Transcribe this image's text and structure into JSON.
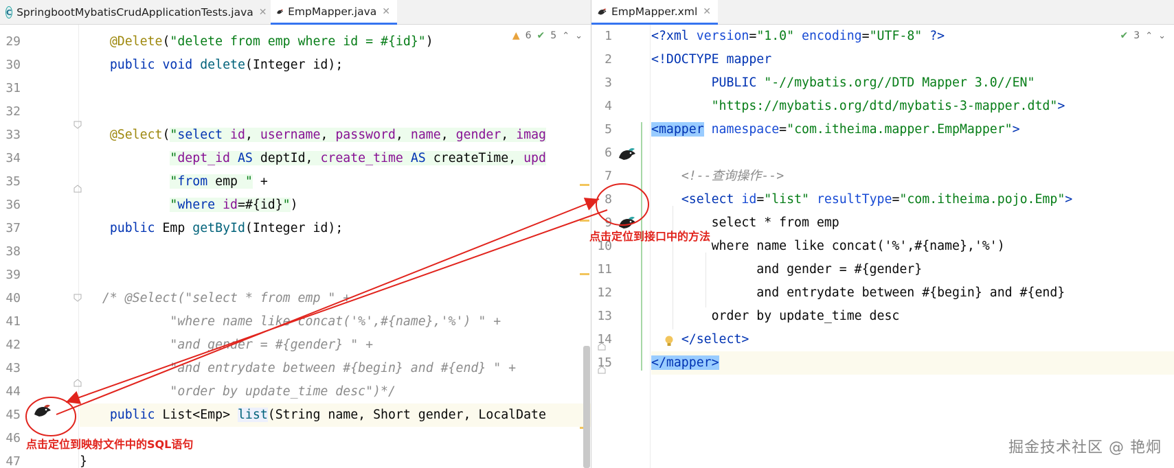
{
  "left_editor": {
    "tabs": [
      {
        "label": "SpringbootMybatisCrudApplicationTests.java",
        "icon": "java-class-icon",
        "active": false
      },
      {
        "label": "EmpMapper.java",
        "icon": "mybatis-bird-icon",
        "active": true
      }
    ],
    "inspection": {
      "warnings": "6",
      "checks": "5"
    },
    "line_numbers": [
      "29",
      "30",
      "31",
      "32",
      "33",
      "34",
      "35",
      "36",
      "37",
      "38",
      "39",
      "40",
      "41",
      "42",
      "43",
      "44",
      "45",
      "46",
      "47"
    ]
  },
  "right_editor": {
    "tabs": [
      {
        "label": "EmpMapper.xml",
        "icon": "mybatis-bird-icon",
        "active": true
      }
    ],
    "inspection": {
      "checks": "3"
    },
    "line_numbers": [
      "1",
      "2",
      "3",
      "4",
      "5",
      "6",
      "7",
      "8",
      "9",
      "10",
      "11",
      "12",
      "13",
      "14",
      "15"
    ]
  },
  "annotations": {
    "left_callout": "点击定位到映射文件中的SQL语句",
    "right_callout": "点击定位到接口中的方法",
    "color": "#e1241d"
  },
  "watermark": "掘金技术社区 @ 艳炯",
  "colors": {
    "keyword": "#0033b3",
    "annotation": "#9e880d",
    "string": "#067d17",
    "comment": "#8c8c8c",
    "active_tab": "#3574f0"
  }
}
